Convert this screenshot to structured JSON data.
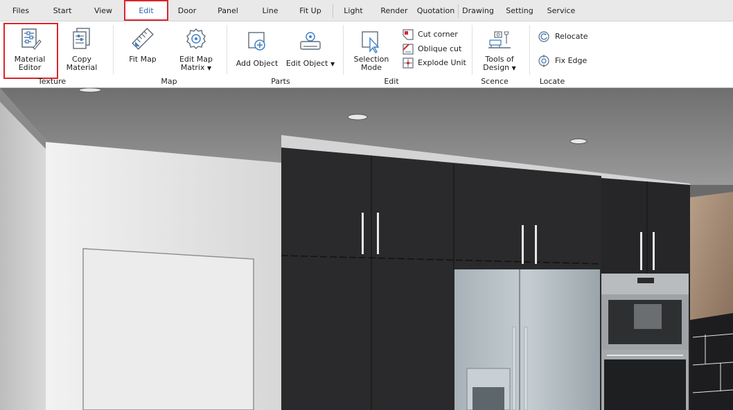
{
  "menu": {
    "tabs": [
      "Files",
      "Start",
      "View",
      "Edit",
      "Door",
      "Panel",
      "Line",
      "Fit Up",
      "Light",
      "Render",
      "Quotation",
      "Drawing",
      "Setting",
      "Service"
    ],
    "active_tab": "Edit"
  },
  "ribbon": {
    "texture": {
      "label": "Texture",
      "material_editor": [
        "Material",
        "Editor"
      ],
      "copy_material": [
        "Copy",
        "Material"
      ]
    },
    "map": {
      "label": "Map",
      "fit_map": "Fit Map",
      "edit_map_matrix": [
        "Edit Map",
        "Matrix"
      ]
    },
    "parts": {
      "label": "Parts",
      "add_object": "Add Object",
      "edit_object": "Edit Object"
    },
    "edit": {
      "label": "Edit",
      "selection_mode": [
        "Selection",
        "Mode"
      ],
      "cut_corner": "Cut corner",
      "oblique_cut": "Oblique cut",
      "explode_unit": "Explode Unit"
    },
    "scene": {
      "label": "Scence",
      "tools_of_design": [
        "Tools of",
        "Design"
      ]
    },
    "locate": {
      "label": "Locate",
      "relocate": "Relocate",
      "fix_edge": "Fix Edge"
    }
  },
  "colors": {
    "accent_red": "#d9262c",
    "active_tab_text": "#2e64a8",
    "icon_gray": "#5f6b7a",
    "icon_blue": "#3f82c8"
  },
  "icons": {
    "material_editor": "sliders-pencil-icon",
    "copy_material": "copy-doc-icon",
    "fit_map": "ruler-diagonal-icon",
    "edit_map_matrix": "gear-icon",
    "add_object": "add-box-icon",
    "edit_object": "settings-tray-icon",
    "selection_mode": "cursor-select-icon",
    "cut_corner": "cut-corner-icon",
    "oblique_cut": "oblique-cut-icon",
    "explode_unit": "explode-icon",
    "tools_of_design": "furniture-design-icon",
    "relocate": "relocate-icon",
    "fix_edge": "fix-edge-icon"
  }
}
